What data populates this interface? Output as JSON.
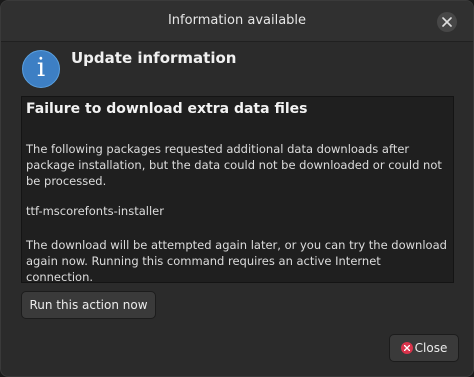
{
  "window": {
    "title": "Information available"
  },
  "dialog": {
    "heading": "Update information",
    "icon": "info-icon",
    "content": {
      "subheading": "Failure to download extra data files",
      "paragraph1": "The following packages requested additional data downloads after package installation, but the data could not be downloaded or could not be processed.",
      "package_name": "ttf-mscorefonts-installer",
      "paragraph3": "The download will be attempted again later, or you can try the download again now.  Running this command requires an active Internet connection."
    },
    "run_button_label": "Run this action now",
    "close_button_label": "Close"
  },
  "colors": {
    "info_accent": "#3d7fc4",
    "close_icon": "#d9334b",
    "window_bg": "#2b2b2b"
  }
}
